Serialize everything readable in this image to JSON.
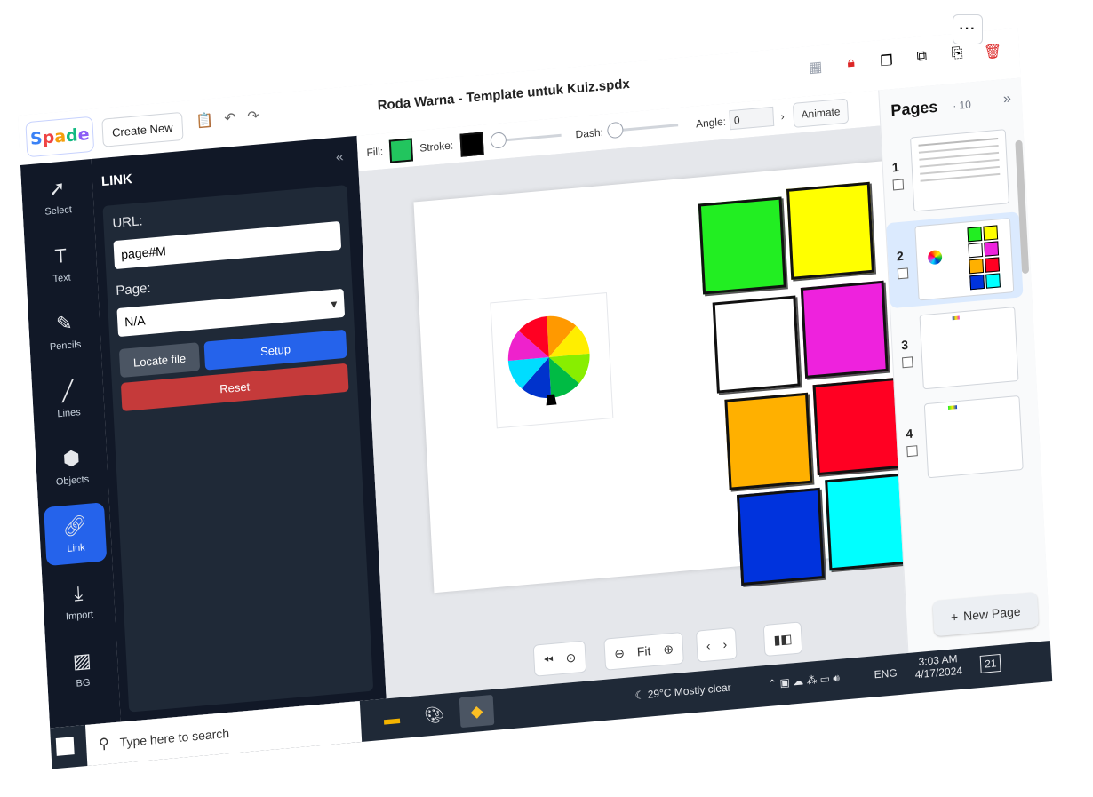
{
  "header": {
    "more_label": "···",
    "logo": [
      "S",
      "p",
      "a",
      "d",
      "e"
    ],
    "create_new": "Create New",
    "doc_title": "Roda Warna - Template untuk Kuiz.spdx"
  },
  "rail": {
    "items": [
      {
        "label": "Select",
        "icon": "pointer-icon"
      },
      {
        "label": "Text",
        "icon": "text-icon"
      },
      {
        "label": "Pencils",
        "icon": "pencil-icon"
      },
      {
        "label": "Lines",
        "icon": "line-icon"
      },
      {
        "label": "Objects",
        "icon": "objects-icon"
      },
      {
        "label": "Link",
        "icon": "link-icon"
      },
      {
        "label": "Import",
        "icon": "import-icon"
      },
      {
        "label": "BG",
        "icon": "bg-icon"
      }
    ]
  },
  "panel": {
    "title": "LINK",
    "url_label": "URL:",
    "url_value": "page#M",
    "page_label": "Page:",
    "page_value": "N/A",
    "locate_file": "Locate file",
    "setup": "Setup",
    "reset": "Reset"
  },
  "toolbar": {
    "fill_label": "Fill:",
    "stroke_label": "Stroke:",
    "dash_label": "Dash:",
    "angle_label": "Angle:",
    "angle_value": "0",
    "animate": "Animate",
    "fill_color": "#22c55e",
    "stroke_color": "#000000"
  },
  "canvas": {
    "cards": [
      "#22ee22",
      "#ffff00",
      "#ffffff",
      "#ee22dd",
      "#ffb000",
      "#ff0022",
      "#0033dd",
      "#00ffff"
    ],
    "zoom_label": "Fit"
  },
  "pages": {
    "title": "Pages",
    "count": "10",
    "numbers": [
      "1",
      "2",
      "3",
      "4"
    ],
    "new_page": "New Page"
  },
  "taskbar": {
    "search_placeholder": "Type here to search",
    "weather": "29°C  Mostly clear",
    "lang": "ENG",
    "time": "3:03 AM",
    "date": "4/17/2024",
    "notif_count": "21"
  }
}
